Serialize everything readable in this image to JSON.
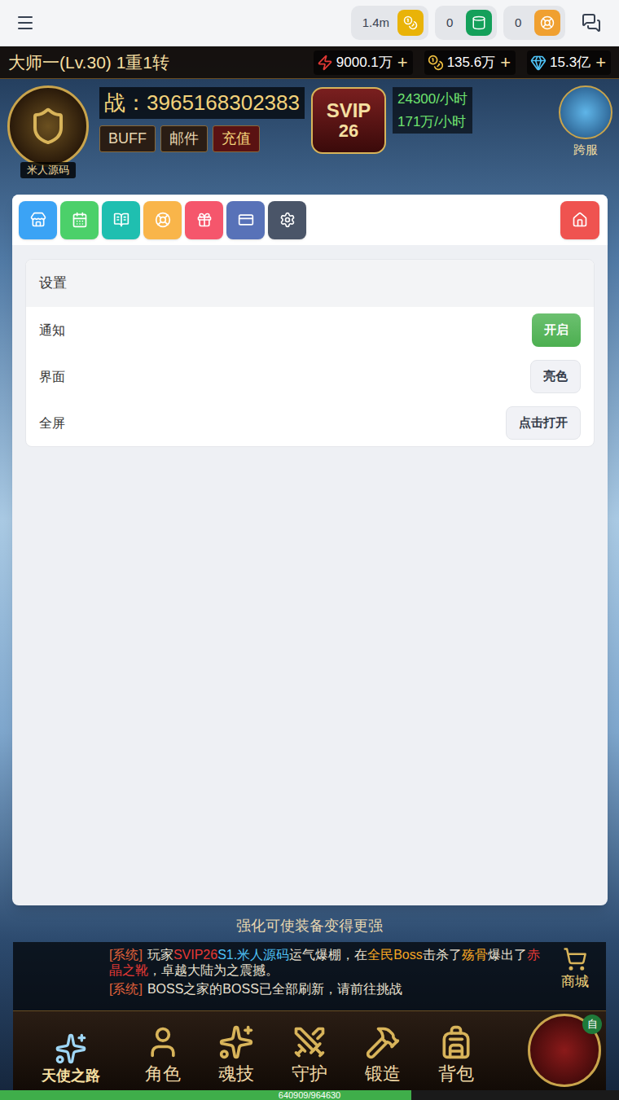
{
  "top_bar": {
    "currencies": [
      {
        "value": "1.4m",
        "color": "#e9b308"
      },
      {
        "value": "0",
        "color": "#14a05a"
      },
      {
        "value": "0",
        "color": "#f0a030"
      }
    ]
  },
  "game": {
    "player": "大师一(Lv.30) 1重1转",
    "resources": [
      {
        "value": "9000.1万",
        "add": "+"
      },
      {
        "value": "135.6万",
        "add": "+"
      },
      {
        "value": "15.3亿",
        "add": "+"
      }
    ],
    "avatar_name": "米人源码",
    "power": "战：3965168302383",
    "hud_buttons": [
      "BUFF",
      "邮件",
      "充值"
    ],
    "vip": {
      "label": "SVIP",
      "level": "26"
    },
    "rates": [
      "24300/小时",
      "171万/小时"
    ],
    "cross_server": "跨服",
    "hint": "强化可使装备变得更强",
    "chat": [
      {
        "tag": "[系统]",
        "parts": [
          {
            "text": "玩家",
            "color": "#e8e0d0"
          },
          {
            "text": "SVIP26",
            "color": "#e53935"
          },
          {
            "text": "S1.米人源码",
            "color": "#4fc3f7"
          },
          {
            "text": "运气爆棚，在",
            "color": "#e8e0d0"
          },
          {
            "text": "全民Boss",
            "color": "#f5a623"
          },
          {
            "text": "击杀了",
            "color": "#e8e0d0"
          },
          {
            "text": "殇骨",
            "color": "#f5a623"
          },
          {
            "text": "爆出了",
            "color": "#e8e0d0"
          },
          {
            "text": "赤晶之靴",
            "color": "#e53935"
          },
          {
            "text": "，卓越大陆为之震撼。",
            "color": "#e8e0d0"
          }
        ]
      },
      {
        "tag": "[系统]",
        "parts": [
          {
            "text": "BOSS之家的BOSS已全部刷新，请前往挑战",
            "color": "#e8e0d0"
          }
        ]
      }
    ],
    "shop": "商城",
    "auto": "自",
    "road": "天使之路",
    "nav": [
      "角色",
      "魂技",
      "守护",
      "锻造",
      "背包"
    ],
    "exp": {
      "reading": "640909/964630",
      "level": 0.6645
    }
  },
  "panel": {
    "tabs": [
      {
        "color": "#3ba3f5"
      },
      {
        "color": "#4cd06a"
      },
      {
        "color": "#1fbfb0"
      },
      {
        "color": "#f9b54a"
      },
      {
        "color": "#f5566c"
      },
      {
        "color": "#5872b8"
      },
      {
        "color": "#4a5568"
      }
    ],
    "home": {
      "color": "#ef5350"
    },
    "card": {
      "title": "设置",
      "rows": [
        {
          "label": "通知",
          "button": "开启",
          "on": true
        },
        {
          "label": "界面",
          "button": "亮色",
          "on": false
        },
        {
          "label": "全屏",
          "button": "点击打开",
          "on": false
        }
      ]
    }
  }
}
